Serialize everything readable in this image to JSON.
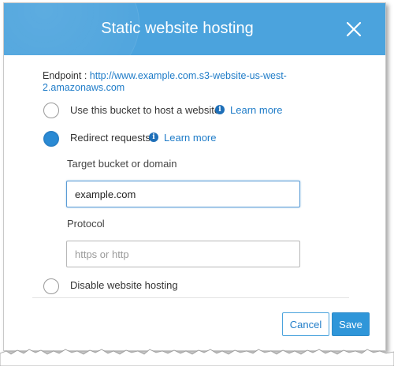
{
  "dialog": {
    "title": "Static website hosting"
  },
  "endpoint": {
    "label": "Endpoint : ",
    "url": "http://www.example.com.s3-website-us-west-2.amazonaws.com"
  },
  "options": [
    {
      "label": "Use this bucket to host a website",
      "checked": false,
      "learn_more": "Learn more",
      "info_icon": "info-icon"
    },
    {
      "label": "Redirect requests",
      "checked": true,
      "learn_more": "Learn more",
      "info_icon": "info-icon"
    },
    {
      "label": "Disable website hosting",
      "checked": false
    }
  ],
  "redirect": {
    "target_label": "Target bucket or domain",
    "target_value": "example.com",
    "protocol_label": "Protocol",
    "protocol_value": "",
    "protocol_placeholder": "https or http"
  },
  "buttons": {
    "cancel": "Cancel",
    "save": "Save"
  },
  "colors": {
    "header": "#4ba3dd",
    "link": "#1f7cc8",
    "primary": "#2f96d9",
    "radio_checked": "#2a8ad4"
  }
}
